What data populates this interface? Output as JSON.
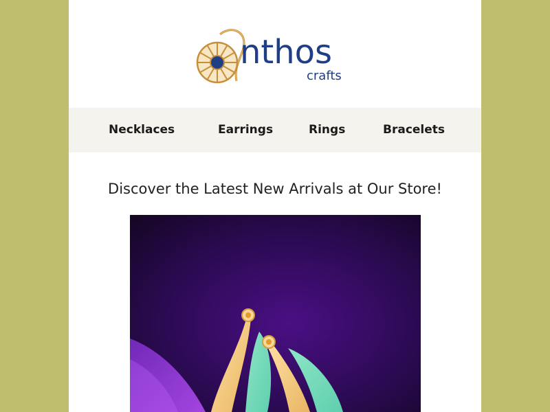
{
  "colors": {
    "outer_background": "#bfbd6e",
    "page_background": "#ffffff",
    "nav_background": "#f4f3ee",
    "brand_blue": "#1f3e86",
    "brand_gold": "#d9a441"
  },
  "logo": {
    "wordmark": "nthos",
    "tagline": "crafts",
    "icon": "daisy-flower-icon"
  },
  "nav": {
    "items": [
      {
        "label": "Necklaces"
      },
      {
        "label": "Earrings"
      },
      {
        "label": "Rings"
      },
      {
        "label": "Bracelets"
      }
    ]
  },
  "main": {
    "headline": "Discover the Latest New Arrivals at Our Store!",
    "hero_image": "earrings-product-photo"
  }
}
